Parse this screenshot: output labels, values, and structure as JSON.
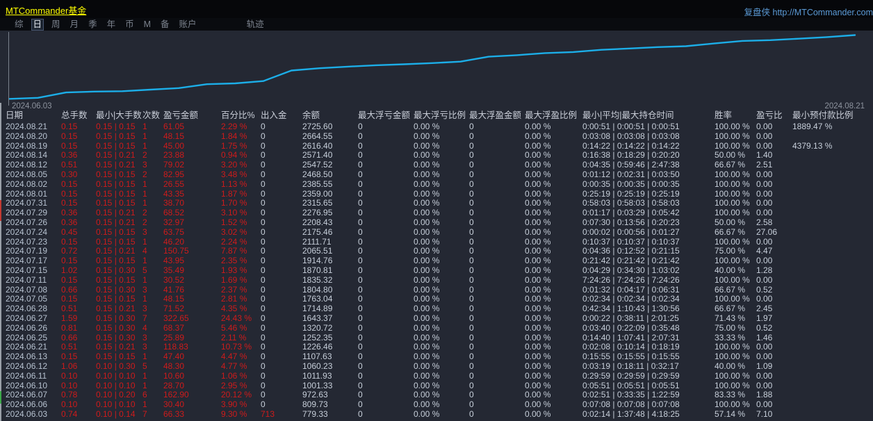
{
  "window": {
    "title": "MTCommander基金",
    "brand_link": "复盘侠 http://MTCommander.com"
  },
  "tabs": {
    "items": [
      {
        "label": "综",
        "active": false
      },
      {
        "label": "日",
        "active": true
      },
      {
        "label": "周",
        "active": false
      },
      {
        "label": "月",
        "active": false
      },
      {
        "label": "季",
        "active": false
      },
      {
        "label": "年",
        "active": false
      },
      {
        "label": "币",
        "active": false
      },
      {
        "label": "M",
        "active": false
      },
      {
        "label": "备",
        "active": false
      },
      {
        "label": "账户",
        "active": false
      },
      {
        "label": "轨迹",
        "active": false,
        "gap_before": true
      }
    ]
  },
  "chart_data": {
    "type": "line",
    "title": "",
    "xlabel": "",
    "ylabel": "余额",
    "x_start_label": "2024.06.03",
    "x_end_label": "2024.08.21",
    "x": [
      "2024.06.03",
      "2024.06.06",
      "2024.06.07",
      "2024.06.10",
      "2024.06.11",
      "2024.06.12",
      "2024.06.13",
      "2024.06.21",
      "2024.06.25",
      "2024.06.26",
      "2024.06.27",
      "2024.06.28",
      "2024.07.05",
      "2024.07.08",
      "2024.07.11",
      "2024.07.15",
      "2024.07.17",
      "2024.07.19",
      "2024.07.23",
      "2024.07.24",
      "2024.07.26",
      "2024.07.29",
      "2024.07.31",
      "2024.08.01",
      "2024.08.02",
      "2024.08.05",
      "2024.08.12",
      "2024.08.14",
      "2024.08.19",
      "2024.08.20",
      "2024.08.21"
    ],
    "series": [
      {
        "name": "余额",
        "values": [
          779.33,
          809.73,
          972.63,
          1001.33,
          1011.93,
          1060.23,
          1107.63,
          1226.46,
          1252.35,
          1320.72,
          1643.37,
          1714.89,
          1763.04,
          1804.8,
          1835.32,
          1870.81,
          1914.76,
          2065.51,
          2111.71,
          2175.46,
          2208.43,
          2276.95,
          2315.65,
          2359.0,
          2385.55,
          2468.5,
          2547.52,
          2571.4,
          2616.4,
          2664.55,
          2725.6
        ]
      }
    ],
    "ylim": [
      700,
      2800
    ],
    "grid": false,
    "legend_position": "none",
    "line_color": "#1caee8"
  },
  "table": {
    "headers": [
      "日期",
      "总手数",
      "最小|大手数",
      "次数",
      "盈亏金额",
      "百分比%",
      "出入金",
      "余额",
      "最大浮亏金额",
      "最大浮亏比例",
      "最大浮盈金额",
      "最大浮盈比例",
      "最小|平均|最大持仓时间",
      "胜率",
      "盈亏比",
      "最小预付款比例"
    ],
    "header_keys": [
      "date",
      "total-lots",
      "min-max-lots",
      "count",
      "pnl-amount",
      "percent",
      "cash-flow",
      "balance",
      "max-float-loss",
      "max-float-loss-pct",
      "max-float-profit",
      "max-float-profit-pct",
      "hold-time",
      "win-rate",
      "pnl-ratio",
      "min-margin-pct"
    ],
    "rows": [
      [
        "2024.08.21",
        "0.15",
        "0.15 | 0.15",
        "1",
        "61.05",
        "2.29 %",
        "0",
        "2725.60",
        "0",
        "0.00 %",
        "0",
        "0.00 %",
        "0:00:51 | 0:00:51 | 0:00:51",
        "100.00 %",
        "0.00",
        "1889.47 %"
      ],
      [
        "2024.08.20",
        "0.15",
        "0.15 | 0.15",
        "1",
        "48.15",
        "1.84 %",
        "0",
        "2664.55",
        "0",
        "0.00 %",
        "0",
        "0.00 %",
        "0:03:08 | 0:03:08 | 0:03:08",
        "100.00 %",
        "0.00",
        ""
      ],
      [
        "2024.08.19",
        "0.15",
        "0.15 | 0.15",
        "1",
        "45.00",
        "1.75 %",
        "0",
        "2616.40",
        "0",
        "0.00 %",
        "0",
        "0.00 %",
        "0:14:22 | 0:14:22 | 0:14:22",
        "100.00 %",
        "0.00",
        "4379.13 %"
      ],
      [
        "2024.08.14",
        "0.36",
        "0.15 | 0.21",
        "2",
        "23.88",
        "0.94 %",
        "0",
        "2571.40",
        "0",
        "0.00 %",
        "0",
        "0.00 %",
        "0:16:38 | 0:18:29 | 0:20:20",
        "50.00 %",
        "1.40",
        ""
      ],
      [
        "2024.08.12",
        "0.51",
        "0.15 | 0.21",
        "3",
        "79.02",
        "3.20 %",
        "0",
        "2547.52",
        "0",
        "0.00 %",
        "0",
        "0.00 %",
        "0:04:35 | 0:59:46 | 2:47:38",
        "66.67 %",
        "2.51",
        ""
      ],
      [
        "2024.08.05",
        "0.30",
        "0.15 | 0.15",
        "2",
        "82.95",
        "3.48 %",
        "0",
        "2468.50",
        "0",
        "0.00 %",
        "0",
        "0.00 %",
        "0:01:12 | 0:02:31 | 0:03:50",
        "100.00 %",
        "0.00",
        ""
      ],
      [
        "2024.08.02",
        "0.15",
        "0.15 | 0.15",
        "1",
        "26.55",
        "1.13 %",
        "0",
        "2385.55",
        "0",
        "0.00 %",
        "0",
        "0.00 %",
        "0:00:35 | 0:00:35 | 0:00:35",
        "100.00 %",
        "0.00",
        ""
      ],
      [
        "2024.08.01",
        "0.15",
        "0.15 | 0.15",
        "1",
        "43.35",
        "1.87 %",
        "0",
        "2359.00",
        "0",
        "0.00 %",
        "0",
        "0.00 %",
        "0:25:19 | 0:25:19 | 0:25:19",
        "100.00 %",
        "0.00",
        ""
      ],
      [
        "2024.07.31",
        "0.15",
        "0.15 | 0.15",
        "1",
        "38.70",
        "1.70 %",
        "0",
        "2315.65",
        "0",
        "0.00 %",
        "0",
        "0.00 %",
        "0:58:03 | 0:58:03 | 0:58:03",
        "100.00 %",
        "0.00",
        ""
      ],
      [
        "2024.07.29",
        "0.36",
        "0.15 | 0.21",
        "2",
        "68.52",
        "3.10 %",
        "0",
        "2276.95",
        "0",
        "0.00 %",
        "0",
        "0.00 %",
        "0:01:17 | 0:03:29 | 0:05:42",
        "100.00 %",
        "0.00",
        ""
      ],
      [
        "2024.07.26",
        "0.36",
        "0.15 | 0.21",
        "2",
        "32.97",
        "1.52 %",
        "0",
        "2208.43",
        "0",
        "0.00 %",
        "0",
        "0.00 %",
        "0:07:30 | 0:13:56 | 0:20:23",
        "50.00 %",
        "2.58",
        ""
      ],
      [
        "2024.07.24",
        "0.45",
        "0.15 | 0.15",
        "3",
        "63.75",
        "3.02 %",
        "0",
        "2175.46",
        "0",
        "0.00 %",
        "0",
        "0.00 %",
        "0:00:02 | 0:00:56 | 0:01:27",
        "66.67 %",
        "27.06",
        ""
      ],
      [
        "2024.07.23",
        "0.15",
        "0.15 | 0.15",
        "1",
        "46.20",
        "2.24 %",
        "0",
        "2111.71",
        "0",
        "0.00 %",
        "0",
        "0.00 %",
        "0:10:37 | 0:10:37 | 0:10:37",
        "100.00 %",
        "0.00",
        ""
      ],
      [
        "2024.07.19",
        "0.72",
        "0.15 | 0.21",
        "4",
        "150.75",
        "7.87 %",
        "0",
        "2065.51",
        "0",
        "0.00 %",
        "0",
        "0.00 %",
        "0:04:36 | 0:12:52 | 0:21:15",
        "75.00 %",
        "4.47",
        ""
      ],
      [
        "2024.07.17",
        "0.15",
        "0.15 | 0.15",
        "1",
        "43.95",
        "2.35 %",
        "0",
        "1914.76",
        "0",
        "0.00 %",
        "0",
        "0.00 %",
        "0:21:42 | 0:21:42 | 0:21:42",
        "100.00 %",
        "0.00",
        ""
      ],
      [
        "2024.07.15",
        "1.02",
        "0.15 | 0.30",
        "5",
        "35.49",
        "1.93 %",
        "0",
        "1870.81",
        "0",
        "0.00 %",
        "0",
        "0.00 %",
        "0:04:29 | 0:34:30 | 1:03:02",
        "40.00 %",
        "1.28",
        ""
      ],
      [
        "2024.07.11",
        "0.15",
        "0.15 | 0.15",
        "1",
        "30.52",
        "1.69 %",
        "0",
        "1835.32",
        "0",
        "0.00 %",
        "0",
        "0.00 %",
        "7:24:26 | 7:24:26 | 7:24:26",
        "100.00 %",
        "0.00",
        ""
      ],
      [
        "2024.07.08",
        "0.66",
        "0.15 | 0.30",
        "3",
        "41.76",
        "2.37 %",
        "0",
        "1804.80",
        "0",
        "0.00 %",
        "0",
        "0.00 %",
        "0:01:32 | 0:04:17 | 0:06:31",
        "66.67 %",
        "0.52",
        ""
      ],
      [
        "2024.07.05",
        "0.15",
        "0.15 | 0.15",
        "1",
        "48.15",
        "2.81 %",
        "0",
        "1763.04",
        "0",
        "0.00 %",
        "0",
        "0.00 %",
        "0:02:34 | 0:02:34 | 0:02:34",
        "100.00 %",
        "0.00",
        ""
      ],
      [
        "2024.06.28",
        "0.51",
        "0.15 | 0.21",
        "3",
        "71.52",
        "4.35 %",
        "0",
        "1714.89",
        "0",
        "0.00 %",
        "0",
        "0.00 %",
        "0:42:34 | 1:10:43 | 1:30:56",
        "66.67 %",
        "2.45",
        ""
      ],
      [
        "2024.06.27",
        "1.59",
        "0.15 | 0.30",
        "7",
        "322.65",
        "24.43 %",
        "0",
        "1643.37",
        "0",
        "0.00 %",
        "0",
        "0.00 %",
        "0:00:22 | 0:38:11 | 2:01:25",
        "71.43 %",
        "1.97",
        ""
      ],
      [
        "2024.06.26",
        "0.81",
        "0.15 | 0.30",
        "4",
        "68.37",
        "5.46 %",
        "0",
        "1320.72",
        "0",
        "0.00 %",
        "0",
        "0.00 %",
        "0:03:40 | 0:22:09 | 0:35:48",
        "75.00 %",
        "0.52",
        ""
      ],
      [
        "2024.06.25",
        "0.66",
        "0.15 | 0.30",
        "3",
        "25.89",
        "2.11 %",
        "0",
        "1252.35",
        "0",
        "0.00 %",
        "0",
        "0.00 %",
        "0:14:40 | 1:07:41 | 2:07:31",
        "33.33 %",
        "1.46",
        ""
      ],
      [
        "2024.06.21",
        "0.51",
        "0.15 | 0.21",
        "3",
        "118.83",
        "10.73 %",
        "0",
        "1226.46",
        "0",
        "0.00 %",
        "0",
        "0.00 %",
        "0:02:08 | 0:10:14 | 0:18:19",
        "100.00 %",
        "0.00",
        ""
      ],
      [
        "2024.06.13",
        "0.15",
        "0.15 | 0.15",
        "1",
        "47.40",
        "4.47 %",
        "0",
        "1107.63",
        "0",
        "0.00 %",
        "0",
        "0.00 %",
        "0:15:55 | 0:15:55 | 0:15:55",
        "100.00 %",
        "0.00",
        ""
      ],
      [
        "2024.06.12",
        "1.06",
        "0.10 | 0.30",
        "5",
        "48.30",
        "4.77 %",
        "0",
        "1060.23",
        "0",
        "0.00 %",
        "0",
        "0.00 %",
        "0:03:19 | 0:18:11 | 0:32:17",
        "40.00 %",
        "1.09",
        ""
      ],
      [
        "2024.06.11",
        "0.10",
        "0.10 | 0.10",
        "1",
        "10.60",
        "1.06 %",
        "0",
        "1011.93",
        "0",
        "0.00 %",
        "0",
        "0.00 %",
        "0:29:59 | 0:29:59 | 0:29:59",
        "100.00 %",
        "0.00",
        ""
      ],
      [
        "2024.06.10",
        "0.10",
        "0.10 | 0.10",
        "1",
        "28.70",
        "2.95 %",
        "0",
        "1001.33",
        "0",
        "0.00 %",
        "0",
        "0.00 %",
        "0:05:51 | 0:05:51 | 0:05:51",
        "100.00 %",
        "0.00",
        ""
      ],
      [
        "2024.06.07",
        "0.78",
        "0.10 | 0.20",
        "6",
        "162.90",
        "20.12 %",
        "0",
        "972.63",
        "0",
        "0.00 %",
        "0",
        "0.00 %",
        "0:02:51 | 0:33:35 | 1:22:59",
        "83.33 %",
        "1.88",
        ""
      ],
      [
        "2024.06.06",
        "0.10",
        "0.10 | 0.10",
        "1",
        "30.40",
        "3.90 %",
        "0",
        "809.73",
        "0",
        "0.00 %",
        "0",
        "0.00 %",
        "0:07:08 | 0:07:08 | 0:07:08",
        "100.00 %",
        "0.00",
        ""
      ],
      [
        "2024.06.03",
        "0.74",
        "0.10 | 0.14",
        "7",
        "66.33",
        "9.30 %",
        "713",
        "779.33",
        "0",
        "0.00 %",
        "0",
        "0.00 %",
        "0:02:14 | 1:37:48 | 4:18:25",
        "57.14 %",
        "7.10",
        ""
      ]
    ]
  },
  "colors": {
    "title_yellow": "#ffff00",
    "link_blue": "#5b9ad6",
    "value_red": "#cf1b1b",
    "value_white": "#c7cfda",
    "date_text": "#b7c2d0",
    "chart_line": "#1caee8",
    "panel_bg": "#242833",
    "bar_bg": "#06070a"
  }
}
